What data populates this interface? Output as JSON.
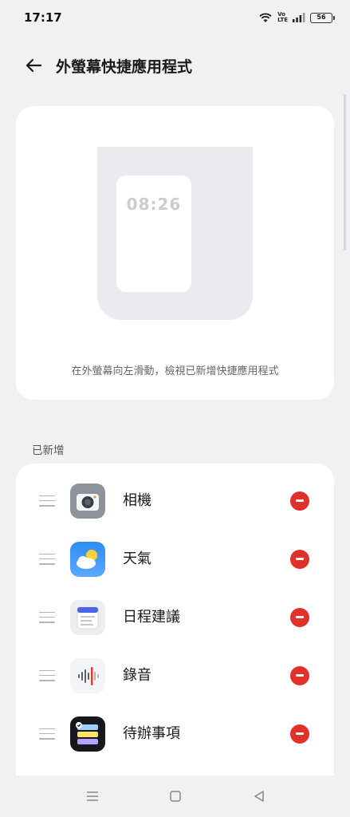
{
  "status_bar": {
    "time": "17:17",
    "battery": "56",
    "icons": [
      "wifi-icon",
      "volte-icon",
      "signal-icon",
      "battery-icon"
    ]
  },
  "header": {
    "title": "外螢幕快捷應用程式",
    "back_icon": "arrow-left-icon"
  },
  "preview": {
    "clock": "08:26",
    "hint": "在外螢幕向左滑動，檢視已新增快捷應用程式"
  },
  "section": {
    "label": "已新增"
  },
  "apps": [
    {
      "name": "相機",
      "icon": "camera-app-icon"
    },
    {
      "name": "天氣",
      "icon": "weather-app-icon"
    },
    {
      "name": "日程建議",
      "icon": "calendar-app-icon"
    },
    {
      "name": "錄音",
      "icon": "recorder-app-icon"
    },
    {
      "name": "待辦事項",
      "icon": "todo-app-icon"
    }
  ],
  "colors": {
    "background": "#f0f1f3",
    "card": "#ffffff",
    "remove": "#e0312b"
  },
  "nav": [
    "menu-icon",
    "home-icon",
    "back-icon"
  ]
}
